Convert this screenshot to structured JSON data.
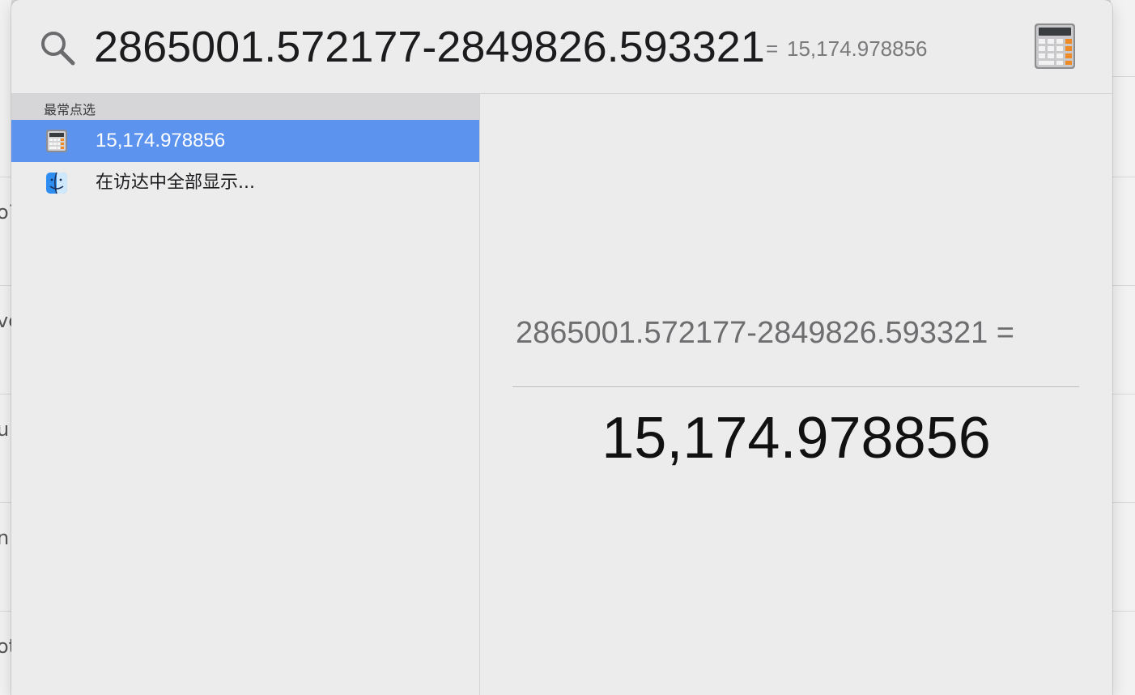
{
  "search": {
    "query": "2865001.572177-2849826.593321",
    "inline_equals": "=",
    "inline_result": "15,174.978856"
  },
  "list": {
    "section_header": "最常点选",
    "items": [
      {
        "label": "15,174.978856",
        "icon": "calculator-icon",
        "selected": true
      },
      {
        "label": "在访达中全部显示...",
        "icon": "finder-icon",
        "selected": false
      }
    ]
  },
  "preview": {
    "expression": "2865001.572177-2849826.593321 =",
    "result": "15,174.978856"
  },
  "background": {
    "side_fragments": [
      "o7",
      "vc",
      "u",
      "n",
      "ot"
    ]
  },
  "colors": {
    "selection": "#5b93ee",
    "panel": "#ececed",
    "header": "#d6d6d8"
  }
}
